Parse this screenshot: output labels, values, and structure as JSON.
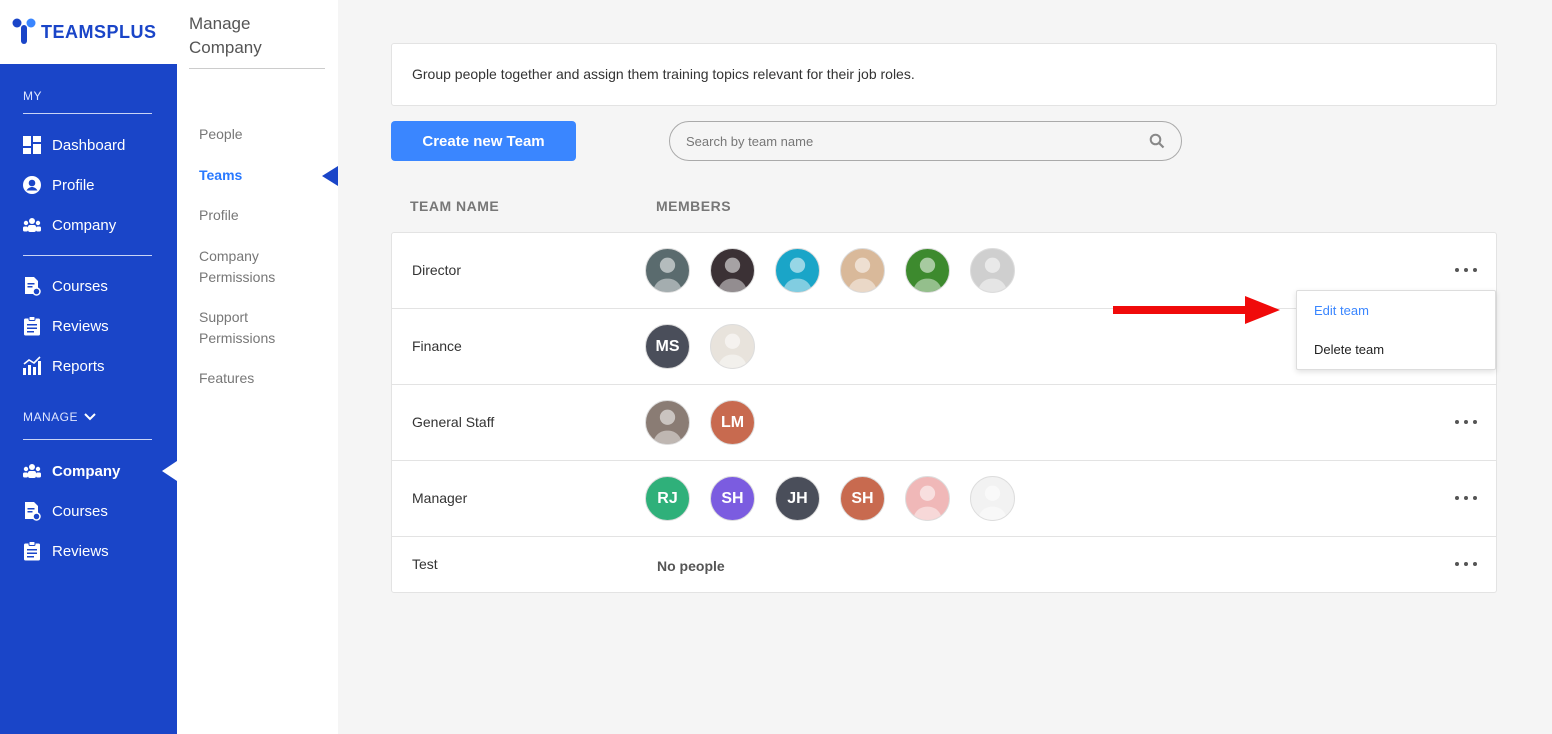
{
  "app": {
    "logo_text": "TEAMSPLUS"
  },
  "sidebar": {
    "section_my": "MY",
    "section_manage": "MANAGE",
    "my_items": [
      {
        "label": "Dashboard",
        "icon": "dashboard-icon"
      },
      {
        "label": "Profile",
        "icon": "user-circle-icon"
      },
      {
        "label": "Company",
        "icon": "users-icon"
      }
    ],
    "learn_items": [
      {
        "label": "Courses",
        "icon": "courses-icon"
      },
      {
        "label": "Reviews",
        "icon": "clipboard-icon"
      },
      {
        "label": "Reports",
        "icon": "chart-icon"
      }
    ],
    "manage_items": [
      {
        "label": "Company",
        "icon": "users-icon",
        "active": true
      },
      {
        "label": "Courses",
        "icon": "courses-icon"
      },
      {
        "label": "Reviews",
        "icon": "clipboard-icon"
      }
    ]
  },
  "subnav": {
    "title": "Manage Company",
    "items": [
      {
        "label": "People"
      },
      {
        "label": "Teams",
        "active": true
      },
      {
        "label": "Profile"
      },
      {
        "label": "Company Permissions"
      },
      {
        "label": "Support Permissions"
      },
      {
        "label": "Features"
      }
    ]
  },
  "main": {
    "description": "Group people together and assign them training topics relevant for their job roles.",
    "create_button": "Create new Team",
    "search_placeholder": "Search by team name",
    "columns": {
      "team_name": "TEAM NAME",
      "members": "MEMBERS"
    },
    "teams": [
      {
        "name": "Director",
        "members": [
          {
            "type": "photo",
            "color": "#5a6b6e"
          },
          {
            "type": "photo",
            "color": "#3b3135"
          },
          {
            "type": "photo",
            "color": "#1aa5c8"
          },
          {
            "type": "photo",
            "color": "#d9b99a"
          },
          {
            "type": "photo",
            "color": "#3d8a2e"
          },
          {
            "type": "photo",
            "color": "#cfcfcf"
          }
        ]
      },
      {
        "name": "Finance",
        "members": [
          {
            "type": "initials",
            "initials": "MS",
            "color": "#4a4e5a"
          },
          {
            "type": "photo",
            "color": "#e8e3dc"
          }
        ]
      },
      {
        "name": "General Staff",
        "members": [
          {
            "type": "photo",
            "color": "#8a7c74"
          },
          {
            "type": "initials",
            "initials": "LM",
            "color": "#c86a4f"
          }
        ]
      },
      {
        "name": "Manager",
        "members": [
          {
            "type": "initials",
            "initials": "RJ",
            "color": "#2fb07a"
          },
          {
            "type": "initials",
            "initials": "SH",
            "color": "#7b5ce0"
          },
          {
            "type": "initials",
            "initials": "JH",
            "color": "#4a4e5a"
          },
          {
            "type": "initials",
            "initials": "SH",
            "color": "#c86a4f"
          },
          {
            "type": "photo",
            "color": "#f0b8b8"
          },
          {
            "type": "photo",
            "color": "#f2f2f2"
          }
        ]
      },
      {
        "name": "Test",
        "members": [],
        "empty_label": "No people"
      }
    ],
    "menu": {
      "edit": "Edit team",
      "delete": "Delete team"
    }
  },
  "colors": {
    "sidebar": "#1a45c8",
    "accent": "#3a86ff",
    "annotation_arrow": "#f00a0a"
  }
}
